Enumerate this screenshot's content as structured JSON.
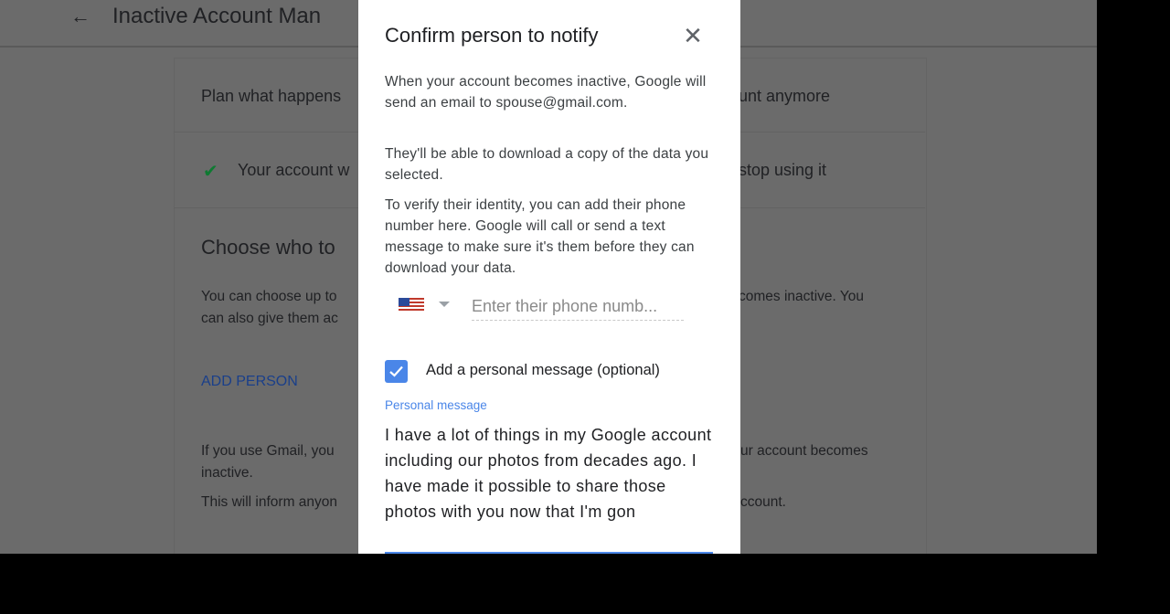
{
  "page": {
    "title": "Inactive Account Man",
    "sections": {
      "plan": "Plan what happens",
      "plan_tail": "unt anymore",
      "account": "Your account w",
      "account_tail": "stop using it",
      "choose_heading": "Choose who to",
      "choose_desc_1": "You can choose up to",
      "choose_desc_1_tail": "comes inactive. You",
      "choose_desc_2": "can also give them ac",
      "add_person": "ADD PERSON",
      "gmail_1": "If you use Gmail, you",
      "gmail_1_tail": "ur account becomes",
      "gmail_2": "inactive.",
      "inform": "This will inform anyon",
      "inform_tail": "ccount."
    }
  },
  "dialog": {
    "title": "Confirm person to notify",
    "para1": "When your account becomes inactive, Google will send an email to spouse@gmail.com.",
    "para2": "They'll be able to download a copy of the data you selected.",
    "para3": "To verify their identity, you can add their phone number here. Google will call or send a text message to make sure it's them before they can download your data.",
    "phone_placeholder": "Enter their phone numb...",
    "checkbox_label": "Add a personal message (optional)",
    "checkbox_checked": true,
    "message_label": "Personal message",
    "message_text": "I have a lot of things in my Google account including our photos from decades ago. I have made it possible to share those photos with you now that I'm gon"
  },
  "colors": {
    "accent": "#4a86e8",
    "check": "#0f7a32"
  },
  "icons": [
    "back-arrow-icon",
    "close-icon",
    "us-flag-icon",
    "chevron-down-icon",
    "checkmark-icon"
  ]
}
